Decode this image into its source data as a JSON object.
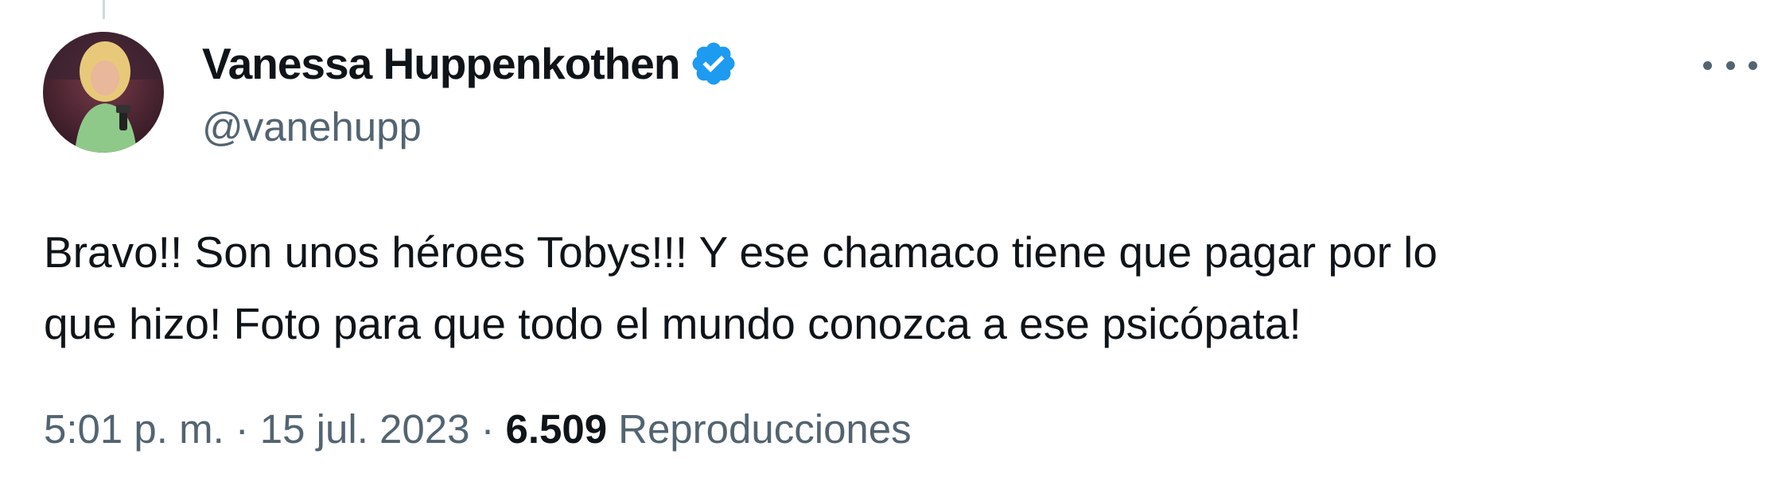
{
  "tweet": {
    "author": {
      "display_name": "Vanessa Huppenkothen",
      "handle": "@vanehupp",
      "verified": true
    },
    "text": "Bravo!! Son unos héroes Tobys!!! Y ese chamaco tiene que pagar por lo\nque hizo! Foto para que todo el mundo conozca a ese psicópata!",
    "meta": {
      "time": "5:01 p. m.",
      "separator": "·",
      "date": "15 jul. 2023",
      "views_count": "6.509",
      "views_label": "Reproducciones"
    }
  },
  "icons": {
    "verified": "verified-badge-icon",
    "more": "more-options-icon"
  },
  "colors": {
    "text_primary": "#0f1419",
    "text_secondary": "#536471",
    "verified_blue": "#1d9bf0",
    "thread_line": "#cfd9de"
  }
}
